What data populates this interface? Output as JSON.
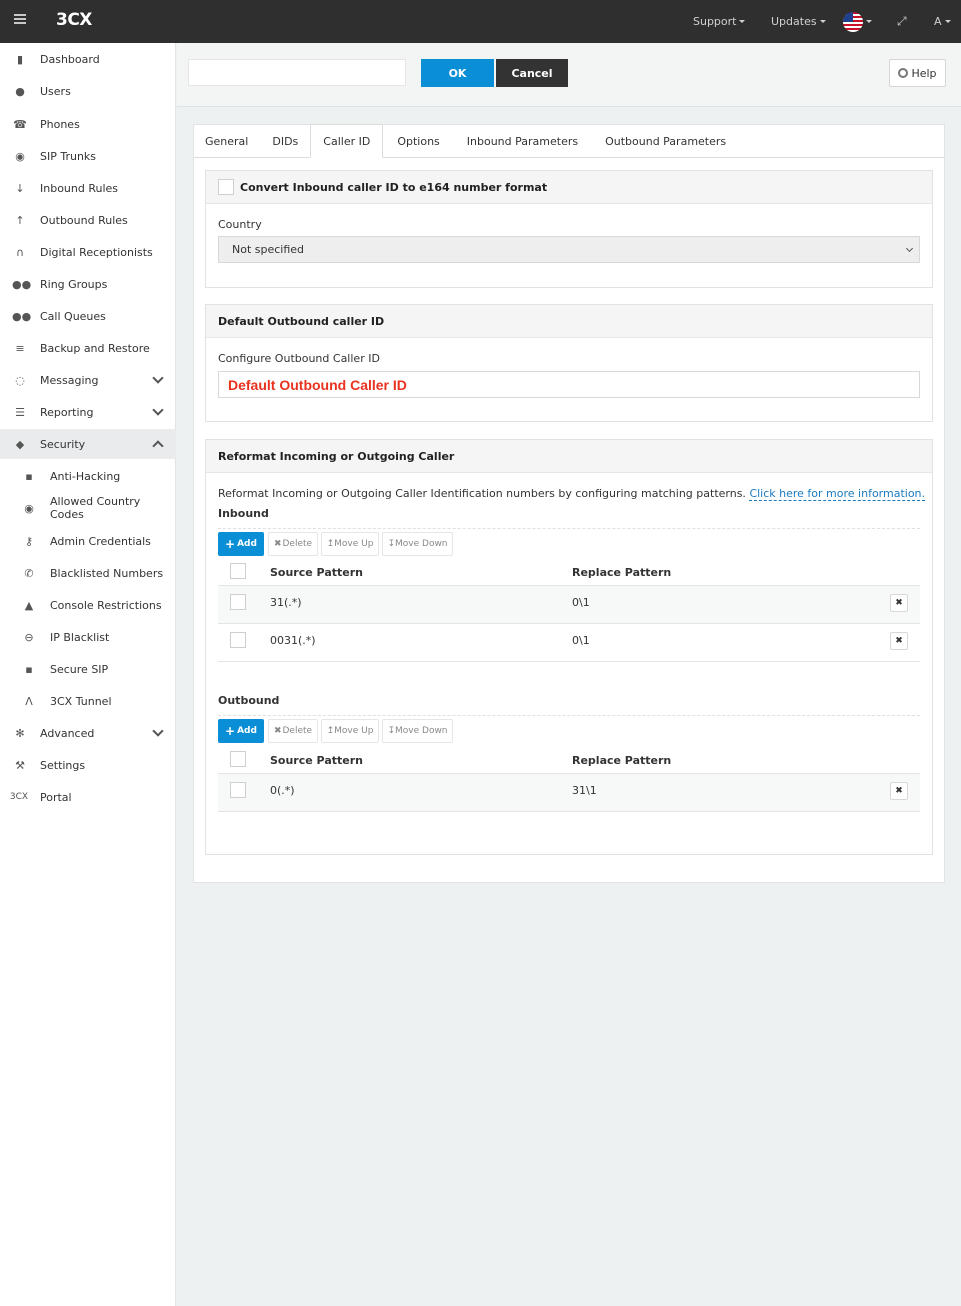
{
  "topbar": {
    "logo": "3CX",
    "support": "Support",
    "updates": "Updates",
    "user": "A"
  },
  "sidebar": {
    "items": [
      {
        "label": "Dashboard",
        "icon": "bar-chart-icon"
      },
      {
        "label": "Users",
        "icon": "user-icon"
      },
      {
        "label": "Phones",
        "icon": "phone-icon"
      },
      {
        "label": "SIP Trunks",
        "icon": "globe-icon"
      },
      {
        "label": "Inbound Rules",
        "icon": "arrow-down-icon"
      },
      {
        "label": "Outbound Rules",
        "icon": "arrow-up-icon"
      },
      {
        "label": "Digital Receptionists",
        "icon": "headset-icon"
      },
      {
        "label": "Ring Groups",
        "icon": "group-icon"
      },
      {
        "label": "Call Queues",
        "icon": "users-icon"
      },
      {
        "label": "Backup and Restore",
        "icon": "database-icon"
      },
      {
        "label": "Messaging",
        "icon": "chat-icon"
      },
      {
        "label": "Reporting",
        "icon": "list-icon"
      },
      {
        "label": "Security",
        "icon": "shield-icon"
      },
      {
        "label": "Anti-Hacking",
        "icon": "lock-icon"
      },
      {
        "label": "Allowed Country Codes",
        "icon": "globe-icon"
      },
      {
        "label": "Admin Credentials",
        "icon": "key-icon"
      },
      {
        "label": "Blacklisted Numbers",
        "icon": "phone-icon"
      },
      {
        "label": "Console Restrictions",
        "icon": "warning-icon"
      },
      {
        "label": "IP Blacklist",
        "icon": "ban-icon"
      },
      {
        "label": "Secure SIP",
        "icon": "lock-icon"
      },
      {
        "label": "3CX Tunnel",
        "icon": "road-icon"
      },
      {
        "label": "Advanced",
        "icon": "gear-icon"
      },
      {
        "label": "Settings",
        "icon": "wrench-icon"
      },
      {
        "label": "Portal",
        "icon": "3cx-logo-icon"
      }
    ]
  },
  "header": {
    "ok": "OK",
    "cancel": "Cancel",
    "help": "Help"
  },
  "tabs": [
    "General",
    "DIDs",
    "Caller ID",
    "Options",
    "Inbound Parameters",
    "Outbound Parameters"
  ],
  "convert_panel": {
    "checkbox_label": "Convert Inbound caller ID to e164 number format",
    "country_label": "Country",
    "country_value": "Not specified"
  },
  "default_panel": {
    "title": "Default Outbound caller ID",
    "field_label": "Configure Outbound Caller ID",
    "field_value": "Default Outbound Caller ID"
  },
  "reformat_panel": {
    "title": "Reformat Incoming or Outgoing Caller",
    "description": "Reformat Incoming or Outgoing Caller Identification numbers by configuring matching patterns.",
    "link": "Click here for more information.",
    "inbound_title": "Inbound",
    "outbound_title": "Outbound",
    "toolbar": {
      "add": "Add",
      "delete": "Delete",
      "move_up": "Move Up",
      "move_down": "Move Down"
    },
    "columns": {
      "source": "Source Pattern",
      "replace": "Replace Pattern"
    },
    "inbound_rows": [
      {
        "source": "31(.*)",
        "replace": "0\\1"
      },
      {
        "source": "0031(.*)",
        "replace": "0\\1"
      }
    ],
    "outbound_rows": [
      {
        "source": "0(.*)",
        "replace": "31\\1"
      }
    ]
  }
}
